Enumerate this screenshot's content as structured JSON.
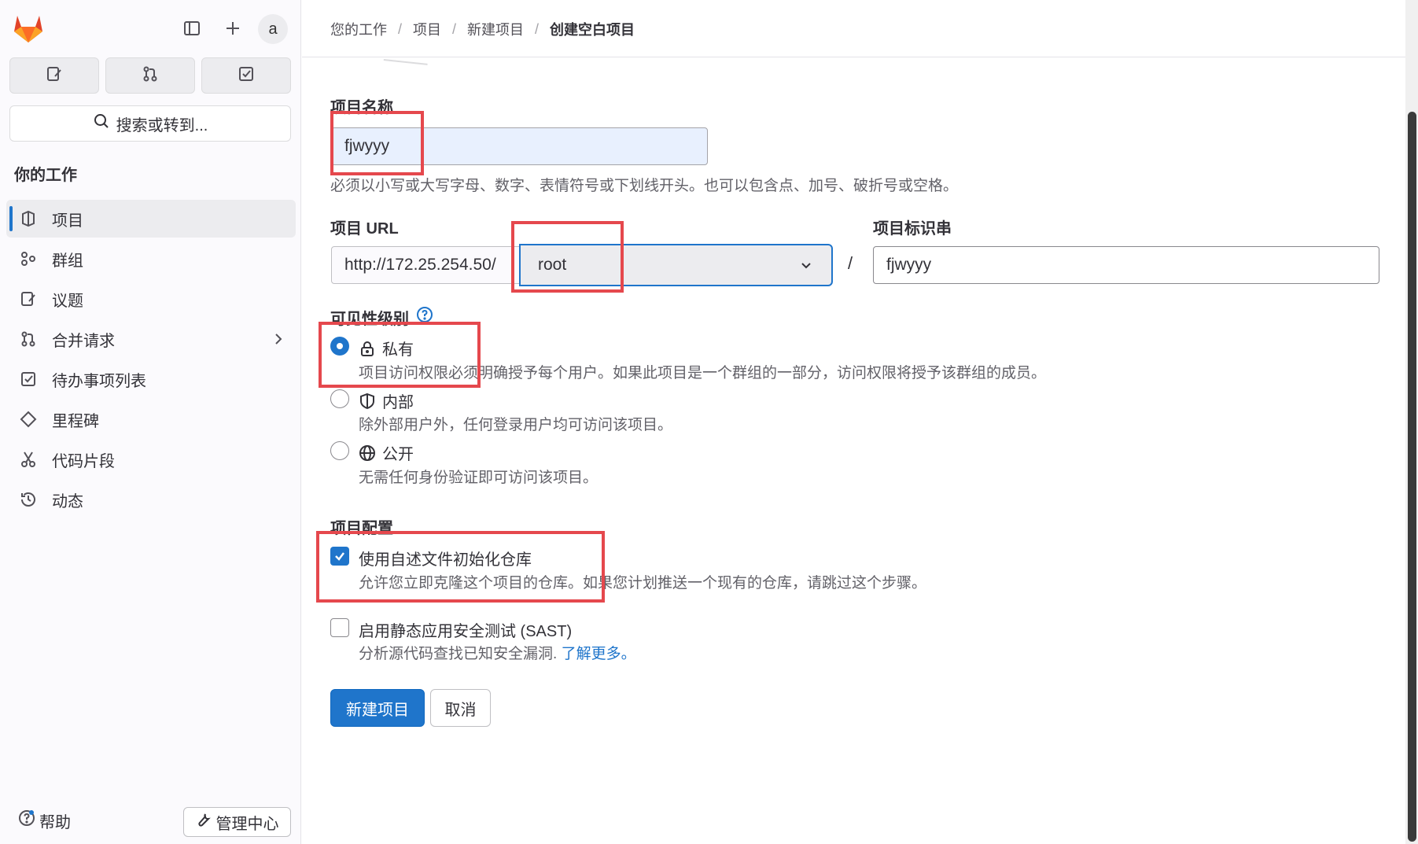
{
  "sidebar": {
    "avatar_text": "a",
    "search_label": "搜索或转到...",
    "section_title": "你的工作",
    "items": [
      {
        "label": "项目",
        "icon": "project-icon",
        "active": true
      },
      {
        "label": "群组",
        "icon": "group-icon"
      },
      {
        "label": "议题",
        "icon": "issues-icon"
      },
      {
        "label": "合并请求",
        "icon": "merge-request-icon",
        "has_chevron": true
      },
      {
        "label": "待办事项列表",
        "icon": "todo-icon"
      },
      {
        "label": "里程碑",
        "icon": "milestone-icon"
      },
      {
        "label": "代码片段",
        "icon": "snippet-icon"
      },
      {
        "label": "动态",
        "icon": "history-icon"
      }
    ],
    "help_label": "帮助",
    "admin_label": "管理中心"
  },
  "breadcrumb": [
    "您的工作",
    "项目",
    "新建项目",
    "创建空白项目"
  ],
  "form": {
    "name_label": "项目名称",
    "name_value": "fjwyyy",
    "name_help": "必须以小写或大写字母、数字、表情符号或下划线开头。也可以包含点、加号、破折号或空格。",
    "url_label": "项目 URL",
    "url_prefix": "http://172.25.254.50/",
    "namespace_value": "root",
    "slash": "/",
    "slug_label": "项目标识串",
    "slug_value": "fjwyyy",
    "visibility_label": "可见性级别",
    "visibility_options": [
      {
        "label": "私有",
        "icon": "lock-icon",
        "desc": "项目访问权限必须明确授予每个用户。如果此项目是一个群组的一部分，访问权限将授予该群组的成员。",
        "checked": true
      },
      {
        "label": "内部",
        "icon": "shield-icon",
        "desc": "除外部用户外，任何登录用户均可访问该项目。",
        "checked": false
      },
      {
        "label": "公开",
        "icon": "earth-icon",
        "desc": "无需任何身份验证即可访问该项目。",
        "checked": false
      }
    ],
    "config_label": "项目配置",
    "readme_label": "使用自述文件初始化仓库",
    "readme_desc": "允许您立即克隆这个项目的仓库。如果您计划推送一个现有的仓库，请跳过这个步骤。",
    "readme_checked": true,
    "sast_label": "启用静态应用安全测试 (SAST)",
    "sast_desc": "分析源代码查找已知安全漏洞.",
    "sast_link": "了解更多。",
    "sast_checked": false,
    "create_button": "新建项目",
    "cancel_button": "取消"
  },
  "colors": {
    "accent": "#1f75cb",
    "highlight_box": "#e5484d",
    "sidebar_bg": "#fbfafd"
  }
}
